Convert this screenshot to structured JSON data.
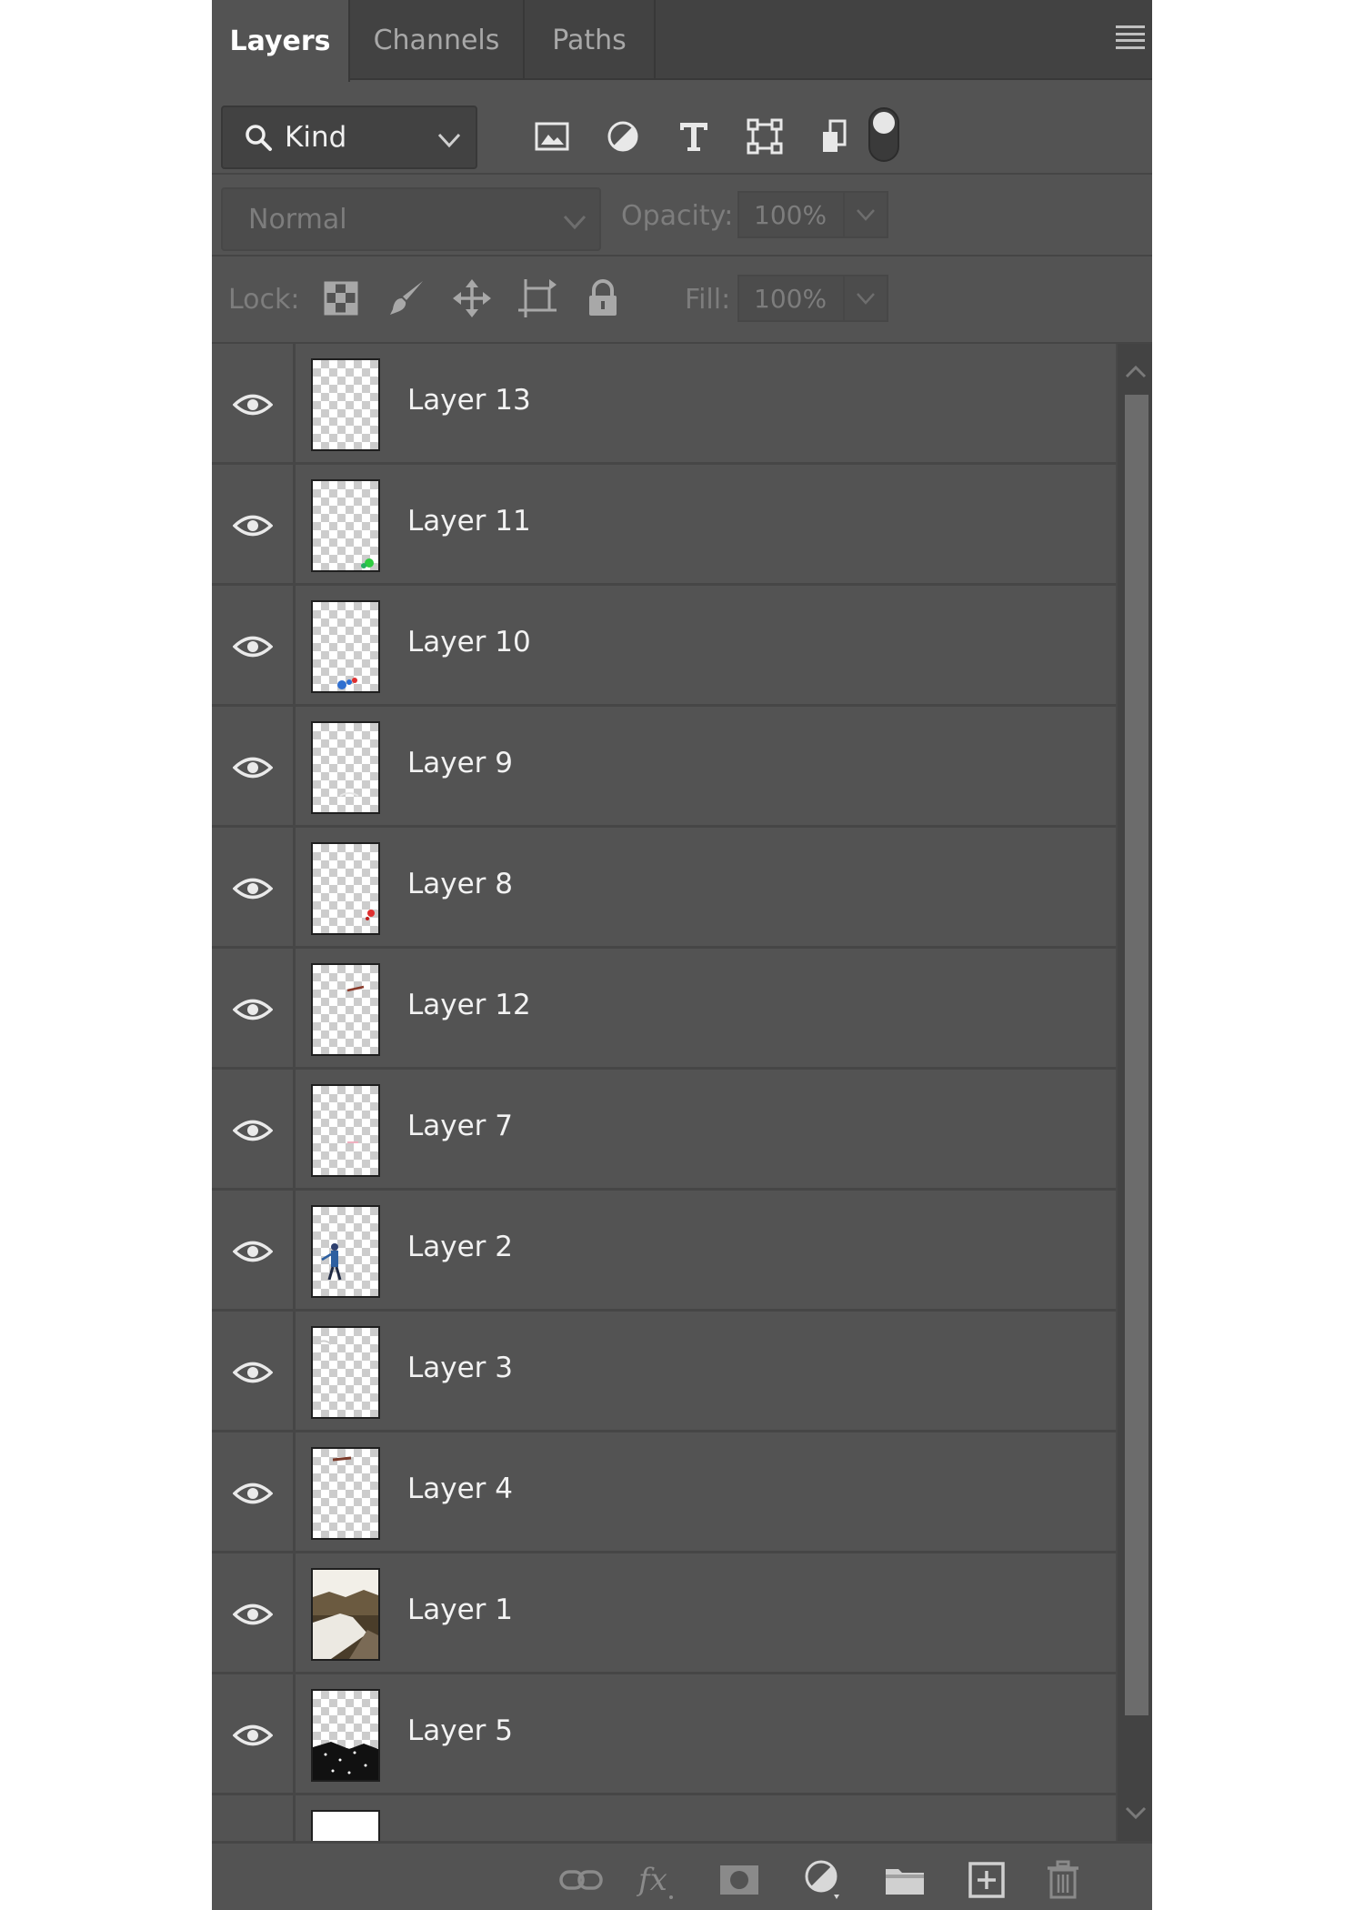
{
  "tabs": [
    {
      "label": "Layers",
      "active": true
    },
    {
      "label": "Channels",
      "active": false
    },
    {
      "label": "Paths",
      "active": false
    }
  ],
  "panel_menu_icon": "hamburger-menu-icon",
  "filter": {
    "kind_label": "Kind",
    "icons": [
      "image-filter-icon",
      "adjustment-filter-icon",
      "type-filter-icon",
      "shape-filter-icon",
      "smart-object-filter-icon"
    ],
    "toggle_on": true
  },
  "blend": {
    "mode": "Normal",
    "opacity_label": "Opacity:",
    "opacity_value": "100%"
  },
  "lock": {
    "label": "Lock:",
    "icons": [
      "lock-transparent-pixels-icon",
      "lock-image-pixels-icon",
      "lock-position-icon",
      "lock-artboard-icon",
      "lock-all-icon"
    ],
    "fill_label": "Fill:",
    "fill_value": "100%"
  },
  "layers": [
    {
      "name": "Layer 13",
      "visible": true,
      "thumb": "blank"
    },
    {
      "name": "Layer 11",
      "visible": true,
      "thumb": "green-spot"
    },
    {
      "name": "Layer 10",
      "visible": true,
      "thumb": "blue-red-spot"
    },
    {
      "name": "Layer 9",
      "visible": true,
      "thumb": "faint"
    },
    {
      "name": "Layer 8",
      "visible": true,
      "thumb": "red-spot"
    },
    {
      "name": "Layer 12",
      "visible": true,
      "thumb": "small-mark"
    },
    {
      "name": "Layer 7",
      "visible": true,
      "thumb": "pink-mark"
    },
    {
      "name": "Layer 2",
      "visible": true,
      "thumb": "figure"
    },
    {
      "name": "Layer 3",
      "visible": true,
      "thumb": "faint-top"
    },
    {
      "name": "Layer 4",
      "visible": true,
      "thumb": "small-mark-top"
    },
    {
      "name": "Layer 1",
      "visible": true,
      "thumb": "photo"
    },
    {
      "name": "Layer 5",
      "visible": true,
      "thumb": "dark-bottom"
    },
    {
      "name": "",
      "visible": false,
      "thumb": "white"
    }
  ],
  "bottom_icons": [
    "link-layers-icon",
    "layer-style-fx-icon",
    "add-mask-icon",
    "new-adjustment-layer-icon",
    "new-group-folder-icon",
    "new-layer-icon",
    "delete-layer-icon"
  ],
  "colors": {
    "panel_bg": "#535353",
    "tab_bar_bg": "#424242",
    "text_active": "#ffffff",
    "text_dim": "#7d7d7d"
  }
}
